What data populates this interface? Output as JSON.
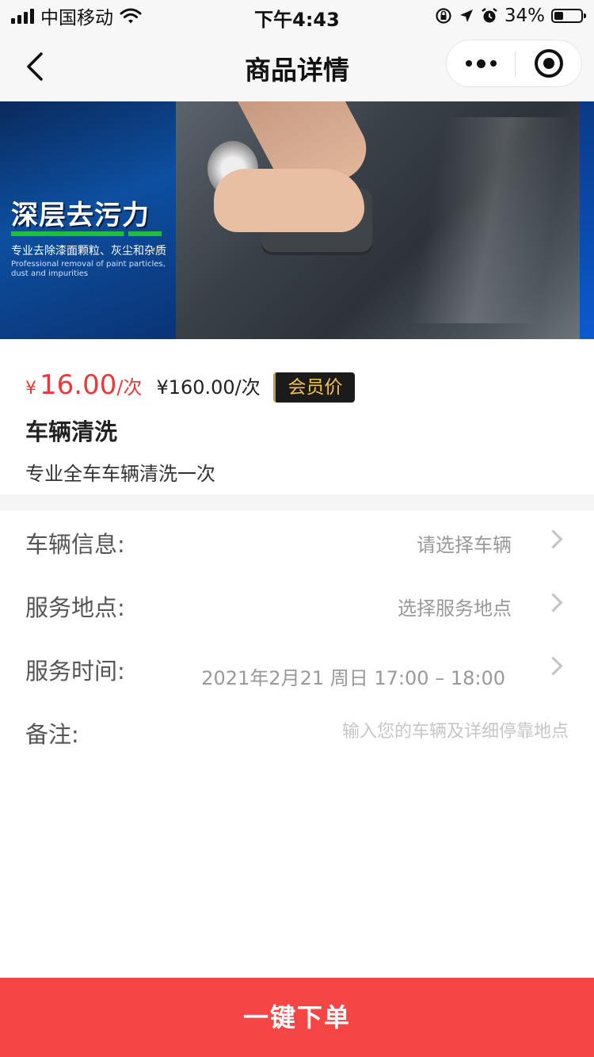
{
  "status_bar": {
    "carrier": "中国移动",
    "time": "下午4:43",
    "battery_text": "34%",
    "battery_level": 0.34
  },
  "nav": {
    "title": "商品详情",
    "icons": [
      "back-arrow-icon",
      "more-dots-icon",
      "close-target-icon"
    ]
  },
  "banner": {
    "headline": "深层去污力",
    "subline": "专业去除漆面颗粒、灰尘和杂质",
    "english": "Professional removal of paint particles, dust and impurities"
  },
  "product": {
    "price_symbol": "¥",
    "price": "16.00",
    "price_unit": "/次",
    "original_price": "¥160.00/次",
    "member_badge": "会员价",
    "name": "车辆清洗",
    "description": "专业全车车辆清洗一次"
  },
  "form": {
    "vehicle": {
      "label": "车辆信息:",
      "value": "请选择车辆"
    },
    "location": {
      "label": "服务地点:",
      "value": "选择服务地点"
    },
    "time": {
      "label": "服务时间:",
      "value": "2021年2月21 周日 17:00 – 18:00"
    },
    "remark": {
      "label": "备注:",
      "placeholder": "输入您的车辆及详细停靠地点"
    }
  },
  "actions": {
    "order_label": "一键下单"
  },
  "colors": {
    "accent_red": "#f54545",
    "price_red": "#e83a3a",
    "badge_gold": "#f2c14e"
  }
}
